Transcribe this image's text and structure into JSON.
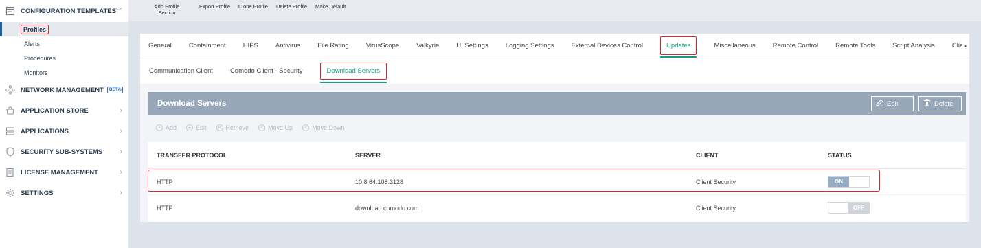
{
  "sidebar": {
    "sections": [
      {
        "label": "CONFIGURATION TEMPLATES",
        "icon": "template-icon"
      },
      {
        "label": "NETWORK MANAGEMENT",
        "badge": "BETA",
        "icon": "network-icon"
      },
      {
        "label": "APPLICATION STORE",
        "icon": "store-icon"
      },
      {
        "label": "APPLICATIONS",
        "icon": "applications-icon"
      },
      {
        "label": "SECURITY SUB-SYSTEMS",
        "icon": "shield-icon"
      },
      {
        "label": "LICENSE MANAGEMENT",
        "icon": "license-icon"
      },
      {
        "label": "SETTINGS",
        "icon": "gear-icon"
      }
    ],
    "sub_items": [
      "Profiles",
      "Alerts",
      "Procedures",
      "Monitors"
    ]
  },
  "toolbar": {
    "add_profile_section_line1": "Add Profile",
    "add_profile_section_line2": "Section",
    "export_profile": "Export Profile",
    "clone_profile": "Clone Profile",
    "delete_profile": "Delete Profile",
    "make_default": "Make Default"
  },
  "tabs": [
    "General",
    "Containment",
    "HIPS",
    "Antivirus",
    "File Rating",
    "VirusScope",
    "Valkyrie",
    "UI Settings",
    "Logging Settings",
    "External Devices Control",
    "Updates",
    "Miscellaneous",
    "Remote Control",
    "Remote Tools",
    "Script Analysis",
    "Client"
  ],
  "tab_scroll_glyph": "▸",
  "subtabs": [
    "Communication Client",
    "Comodo Client - Security",
    "Download Servers"
  ],
  "panel": {
    "title": "Download Servers",
    "edit_label": "Edit",
    "delete_label": "Delete"
  },
  "actions": {
    "add": "Add",
    "edit": "Edit",
    "remove": "Remove",
    "move_up": "Move Up",
    "move_down": "Move Down"
  },
  "table": {
    "columns": [
      "TRANSFER PROTOCOL",
      "SERVER",
      "CLIENT",
      "STATUS"
    ],
    "rows": [
      {
        "protocol": "HTTP",
        "server": "10.8.64.108:3128",
        "client": "Client Security",
        "status": "ON"
      },
      {
        "protocol": "HTTP",
        "server": "download.comodo.com",
        "client": "Client Security",
        "status": "OFF"
      }
    ]
  },
  "colors": {
    "accent_green": "#13a07f",
    "highlight_red": "#d9262c",
    "panel_header": "#97a7b8",
    "toggle_on": "#97adc5"
  }
}
